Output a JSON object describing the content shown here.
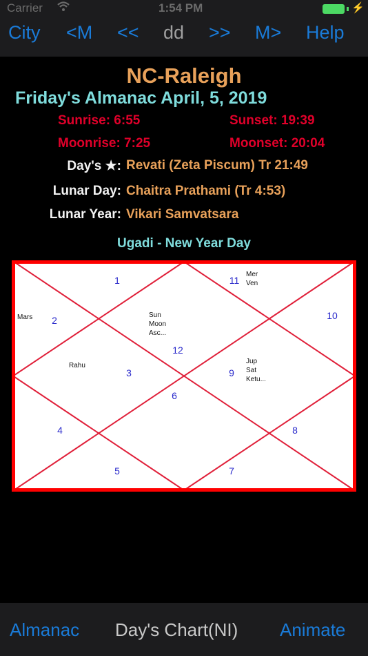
{
  "status": {
    "carrier": "Carrier",
    "time": "1:54 PM"
  },
  "nav": {
    "city": "City",
    "prev_month": "<M",
    "prev": "<<",
    "day": "dd",
    "next": ">>",
    "next_month": "M>",
    "help": "Help"
  },
  "header": {
    "city_name": "NC-Raleigh",
    "title": "Friday's Almanac April, 5, 2019"
  },
  "times": {
    "sunrise": "Sunrise: 6:55",
    "sunset": "Sunset: 19:39",
    "moonrise": "Moonrise: 7:25",
    "moonset": "Moonset: 20:04"
  },
  "details": {
    "star_label": "Day's ★:",
    "star_value": "Revati (Zeta Piscum) Tr 21:49",
    "lunar_day_label": "Lunar Day:",
    "lunar_day_value": "Chaitra Prathami (Tr 4:53)",
    "lunar_year_label": "Lunar Year:",
    "lunar_year_value": "Vikari Samvatsara"
  },
  "festival": "Ugadi - New Year Day",
  "chart": {
    "houses": [
      "1",
      "2",
      "3",
      "4",
      "5",
      "6",
      "7",
      "8",
      "9",
      "10",
      "11",
      "12"
    ],
    "planets": {
      "house1": [],
      "house2": [
        "Mars"
      ],
      "house3": [
        "Rahu"
      ],
      "house9": [
        "Jup",
        "Sat",
        "Ketu..."
      ],
      "house11": [
        "Mer",
        "Ven"
      ],
      "house12": [
        "Sun",
        "Moon",
        "Asc..."
      ]
    },
    "border_color": "#ff0000",
    "line_color": "#e0203a",
    "number_color": "#2a2acb"
  },
  "tabs": {
    "almanac": "Almanac",
    "days_chart": "Day's Chart(NI)",
    "animate": "Animate"
  },
  "colors": {
    "accent": "#1a7bd8",
    "title_orange": "#e8a15a",
    "title_cyan": "#7fdcdc",
    "alert_red": "#e0002a"
  }
}
